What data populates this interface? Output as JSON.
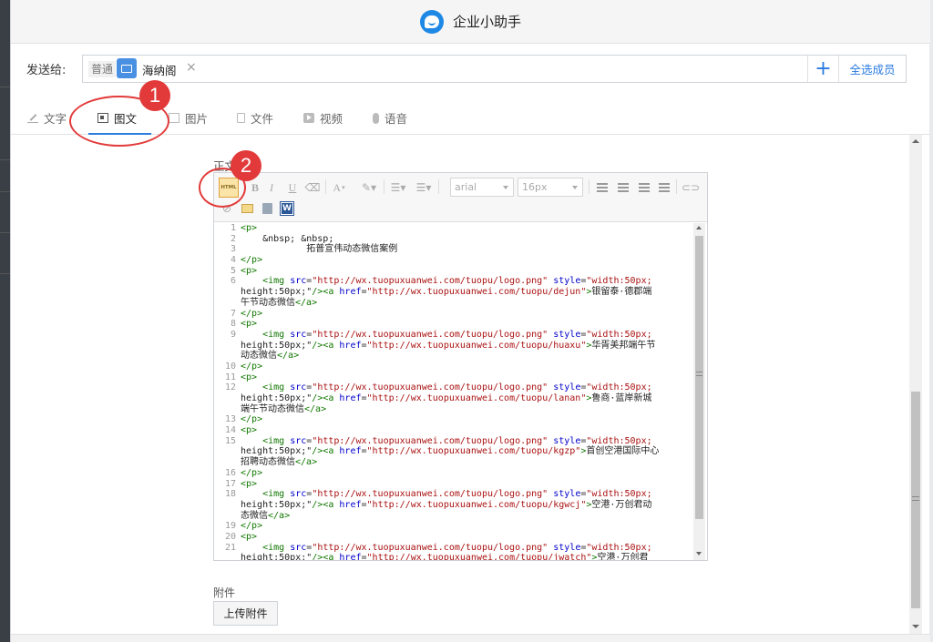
{
  "window": {
    "title": "企业小助手"
  },
  "send_to": {
    "label": "发送给:",
    "tag_normal": "普通",
    "recipient": "海纳阁",
    "remove_symbol": "×",
    "add_symbol": "+",
    "select_all": "全选成员"
  },
  "tabs": [
    {
      "label": "文字",
      "icon": "pen-icon"
    },
    {
      "label": "图文",
      "icon": "news-icon",
      "active": true
    },
    {
      "label": "图片",
      "icon": "image-icon"
    },
    {
      "label": "文件",
      "icon": "file-icon"
    },
    {
      "label": "视频",
      "icon": "video-icon"
    },
    {
      "label": "语音",
      "icon": "mic-icon"
    }
  ],
  "editor": {
    "label": "正文",
    "toolbar": {
      "html": "HTML",
      "bold": "B",
      "italic": "I",
      "underline": "U",
      "font_color": "A",
      "font_family": "arial",
      "font_size": "16px",
      "word": "W"
    },
    "code_lines": [
      "<p>",
      "    &nbsp; &nbsp;",
      "            拓普宣伟动态微信案例",
      "</p>",
      "<p>",
      "    <img src=\"http://wx.tuopuxuanwei.com/tuopu/logo.png\" style=\"width:50px;",
      "height:50px;\"/><a href=\"http://wx.tuopuxuanwei.com/tuopu/dejun\">银留泰·德郡端",
      "午节动态微信</a>",
      "</p>",
      "<p>",
      "    <img src=\"http://wx.tuopuxuanwei.com/tuopu/logo.png\" style=\"width:50px;",
      "height:50px;\"/><a href=\"http://wx.tuopuxuanwei.com/tuopu/huaxu\">华胥美邦端午节",
      "动态微信</a>",
      "</p>",
      "<p>",
      "    <img src=\"http://wx.tuopuxuanwei.com/tuopu/logo.png\" style=\"width:50px;",
      "height:50px;\"/><a href=\"http://wx.tuopuxuanwei.com/tuopu/lanan\">鲁商·蓝岸新城",
      "端午节动态微信</a>",
      "</p>",
      "<p>",
      "    <img src=\"http://wx.tuopuxuanwei.com/tuopu/logo.png\" style=\"width:50px;",
      "height:50px;\"/><a href=\"http://wx.tuopuxuanwei.com/tuopu/kgzp\">首创空港国际中心",
      "招聘动态微信</a>",
      "</p>",
      "<p>",
      "    <img src=\"http://wx.tuopuxuanwei.com/tuopu/logo.png\" style=\"width:50px;",
      "height:50px;\"/><a href=\"http://wx.tuopuxuanwei.com/tuopu/kgwcj\">空港·万创君动",
      "态微信</a>",
      "</p>",
      "<p>",
      "    <img src=\"http://wx.tuopuxuanwei.com/tuopu/logo.png\" style=\"width:50px;",
      "height:50px;\"/><a href=\"http://wx.tuopuxuanwei.com/tuopu/jwatch\">空港·万创君"
    ],
    "line_numbers": [
      "1",
      "2",
      "3",
      "4",
      "5",
      "6",
      "",
      "",
      "7",
      "8",
      "9",
      "",
      "",
      "10",
      "11",
      "12",
      "",
      "",
      "13",
      "14",
      "15",
      "",
      "",
      "16",
      "17",
      "18",
      "",
      "",
      "19",
      "20",
      "21",
      ""
    ]
  },
  "attachment": {
    "label": "附件",
    "upload": "上传附件"
  },
  "annotations": [
    {
      "number": "1"
    },
    {
      "number": "2"
    }
  ],
  "colors": {
    "accent": "#2b7be0",
    "annotation": "#e23a3a"
  }
}
